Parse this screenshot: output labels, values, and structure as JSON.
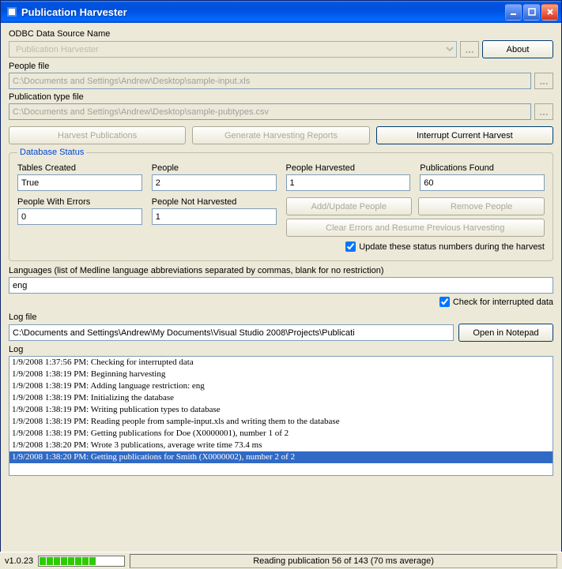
{
  "window": {
    "title": "Publication Harvester"
  },
  "odbc": {
    "label": "ODBC Data Source Name",
    "value": "Publication Harvester",
    "browse": "...",
    "about": "About"
  },
  "people_file": {
    "label": "People file",
    "value": "C:\\Documents and Settings\\Andrew\\Desktop\\sample-input.xls",
    "browse": "..."
  },
  "pubtype_file": {
    "label": "Publication type file",
    "value": "C:\\Documents and Settings\\Andrew\\Desktop\\sample-pubtypes.csv",
    "browse": "..."
  },
  "main_buttons": {
    "harvest": "Harvest Publications",
    "reports": "Generate Harvesting Reports",
    "interrupt": "Interrupt Current Harvest"
  },
  "db_status": {
    "legend": "Database Status",
    "tables_created": {
      "label": "Tables Created",
      "value": "True"
    },
    "people": {
      "label": "People",
      "value": "2"
    },
    "people_harvested": {
      "label": "People Harvested",
      "value": "1"
    },
    "pubs_found": {
      "label": "Publications Found",
      "value": "60"
    },
    "people_errors": {
      "label": "People With Errors",
      "value": "0"
    },
    "people_not_harvested": {
      "label": "People Not Harvested",
      "value": "1"
    },
    "add_update": "Add/Update People",
    "remove": "Remove People",
    "clear_errors": "Clear Errors and Resume Previous Harvesting",
    "update_check": "Update these status numbers during the harvest"
  },
  "languages": {
    "label": "Languages (list of Medline language abbreviations separated by commas, blank for no restriction)",
    "value": "eng"
  },
  "interrupted_check": "Check for interrupted data",
  "logfile": {
    "label": "Log file",
    "value": "C:\\Documents and Settings\\Andrew\\My Documents\\Visual Studio 2008\\Projects\\Publicati",
    "open": "Open in Notepad"
  },
  "log": {
    "label": "Log",
    "lines": [
      "1/9/2008 1:37:56 PM: Checking for interrupted data",
      "1/9/2008 1:38:19 PM: Beginning harvesting",
      "1/9/2008 1:38:19 PM: Adding language restriction: eng",
      "1/9/2008 1:38:19 PM: Initializing the database",
      "1/9/2008 1:38:19 PM: Writing publication types to database",
      "1/9/2008 1:38:19 PM: Reading people from sample-input.xls and writing them to the database",
      "1/9/2008 1:38:19 PM: Getting publications for Doe (X0000001), number 1 of 2",
      "1/9/2008 1:38:20 PM: Wrote 3 publications, average write time 73.4 ms",
      "1/9/2008 1:38:20 PM: Getting publications for Smith (X0000002), number 2 of 2"
    ],
    "selected_index": 8
  },
  "statusbar": {
    "version": "v1.0.23",
    "message": "Reading publication 56 of 143 (70 ms average)"
  }
}
